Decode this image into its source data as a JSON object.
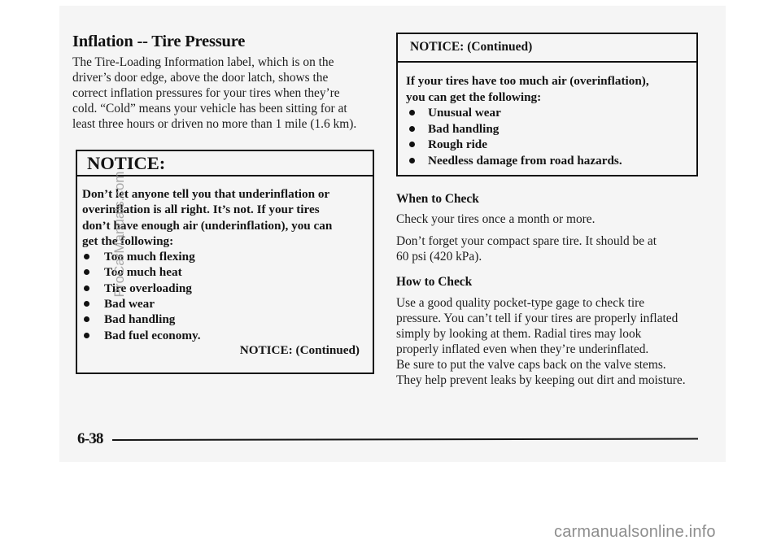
{
  "page": {
    "heading": "Inflation -- Tire Pressure",
    "intro": "The Tire-Loading Information label, which is on the driver’s door edge, above the door latch, shows the correct inflation pressures for your tires when they’re cold. “Cold” means your vehicle has been sitting for at least three hours or driven no more than 1 mile (1.6 km).",
    "intro_lines": [
      "The Tire-Loading Information label, which is on the",
      "driver’s door edge, above the door latch, shows the",
      "correct inflation pressures for your tires when they’re",
      "cold. “Cold” means your vehicle has been sitting for at",
      "least three hours or driven no more than 1 mile (1.6 km)."
    ],
    "notice_left": {
      "title": "NOTICE:",
      "body_lines": [
        "Don’t let anyone tell you that underinflation or",
        "overinflation is all right. It’s not. If your tires",
        "don’t have enough air (underinflation), you can",
        "get the following:"
      ],
      "bullets": [
        "Too much flexing",
        "Too much heat",
        "Tire overloading",
        "Bad wear",
        "Bad handling",
        "Bad fuel economy."
      ],
      "continued_label": "NOTICE: (Continued)"
    },
    "notice_right": {
      "title": "NOTICE: (Continued)",
      "body_lines": [
        "If your tires have too much air (overinflation),",
        "you can get the following:"
      ],
      "bullets": [
        "Unusual wear",
        "Bad handling",
        "Rough ride",
        "Needless damage from road hazards."
      ]
    },
    "when_to_check": {
      "heading": "When to Check",
      "p1": "Check your tires once a month or more.",
      "p2_lines": [
        "Don’t forget your compact spare tire. It should be at",
        "60 psi (420 kPa)."
      ]
    },
    "how_to_check": {
      "heading": "How to Check",
      "p1_lines": [
        "Use a good quality pocket-type gage to check tire",
        "pressure. You can’t tell if your tires are properly inflated",
        "simply by looking at them. Radial tires may look",
        "properly inflated even when they’re underinflated."
      ],
      "p2_lines": [
        "Be sure to put the valve caps back on the valve stems.",
        "They help prevent leaks by keeping out dirt and moisture."
      ]
    },
    "page_number": "6-38"
  },
  "watermarks": {
    "vertical": "ProCarManuals.com",
    "bottom": "carmanualsonline.info"
  }
}
